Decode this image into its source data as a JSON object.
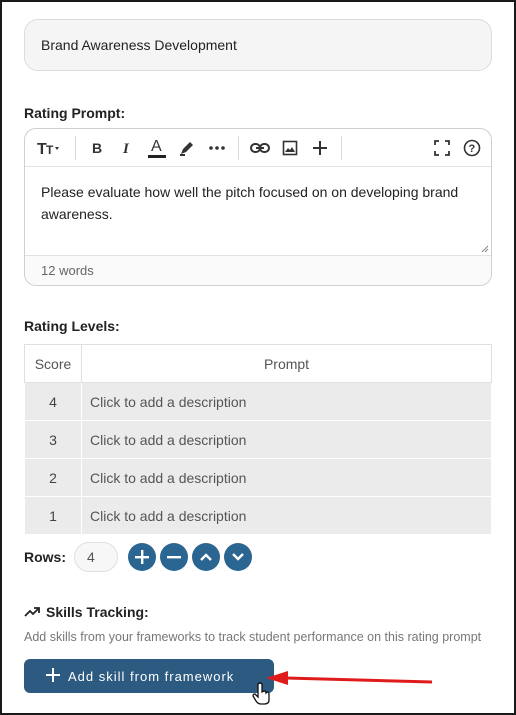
{
  "title_field": {
    "value": "Brand Awareness Development"
  },
  "rating_prompt": {
    "label": "Rating Prompt:",
    "text": "Please evaluate how well the pitch focused on on developing brand awareness.",
    "word_count": "12 words",
    "toolbar": [
      "text-size-icon",
      "bold-icon",
      "italic-icon",
      "font-color-icon",
      "highlight-icon",
      "more-icon",
      "link-icon",
      "image-icon",
      "insert-icon",
      "fullscreen-icon",
      "help-icon"
    ]
  },
  "rating_levels": {
    "label": "Rating Levels:",
    "headers": {
      "score": "Score",
      "prompt": "Prompt"
    },
    "rows": [
      {
        "score": "4",
        "prompt": "Click to add a description"
      },
      {
        "score": "3",
        "prompt": "Click to add a description"
      },
      {
        "score": "2",
        "prompt": "Click to add a description"
      },
      {
        "score": "1",
        "prompt": "Click to add a description"
      }
    ]
  },
  "rows_control": {
    "label": "Rows:",
    "value": "4"
  },
  "skills": {
    "title": "Skills Tracking:",
    "description": "Add skills from your frameworks to track student performance on this rating prompt",
    "button_label": "Add skill from framework"
  },
  "colors": {
    "accent": "#2b6591",
    "button": "#2c5a80",
    "annotation_arrow": "#e01b1b"
  }
}
